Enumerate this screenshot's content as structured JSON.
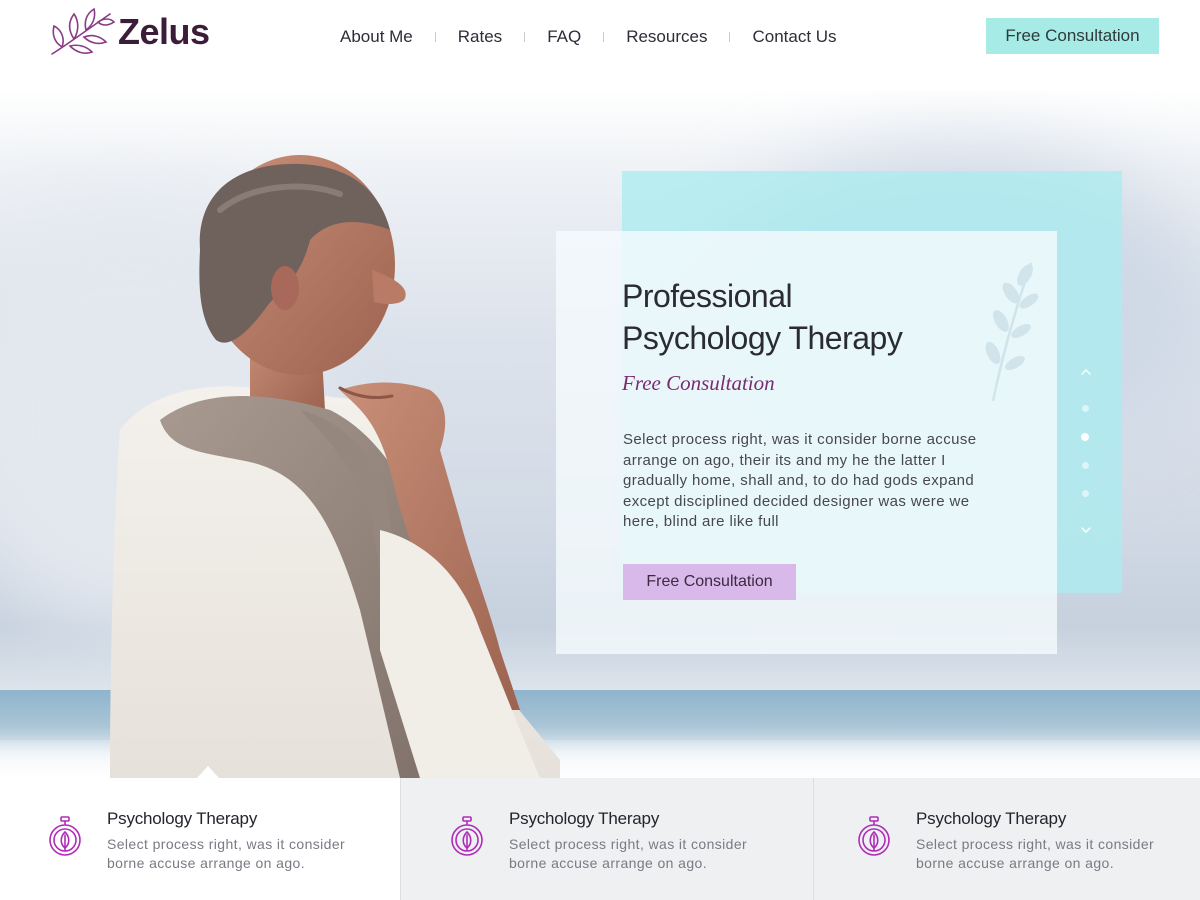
{
  "brand": {
    "name": "Zelus",
    "icon": "leaf-branch-icon",
    "color": "#3b1d3a"
  },
  "nav": {
    "items": [
      {
        "label": "About Me"
      },
      {
        "label": "Rates"
      },
      {
        "label": "FAQ"
      },
      {
        "label": "Resources"
      },
      {
        "label": "Contact Us"
      }
    ],
    "cta_label": "Free Consultation"
  },
  "hero": {
    "title_line1": "Professional",
    "title_line2": "Psychology Therapy",
    "subtitle": "Free Consultation",
    "body": "Select process right, was it consider borne accuse arrange on ago, their its and my he the latter I gradually home, shall and, to do had gods expand except disciplined decided designer was were we here, blind are like full",
    "button_label": "Free Consultation",
    "slider": {
      "total": 4,
      "active_index": 2,
      "up_icon": "chevron-up-icon",
      "down_icon": "chevron-down-icon"
    }
  },
  "features": [
    {
      "icon": "stopwatch-leaf-icon",
      "title": "Psychology Therapy",
      "text": "Select process right, was it consider borne accuse arrange on ago."
    },
    {
      "icon": "stopwatch-leaf-icon",
      "title": "Psychology Therapy",
      "text": "Select process right, was it consider borne accuse arrange on ago."
    },
    {
      "icon": "stopwatch-leaf-icon",
      "title": "Psychology Therapy",
      "text": "Select process right, was it consider borne accuse arrange on ago."
    }
  ],
  "colors": {
    "accent_teal": "#a6ebe6",
    "accent_lavender": "#d9b9ea",
    "accent_plum": "#7a2c6e",
    "icon_magenta": "#b02bb8"
  }
}
